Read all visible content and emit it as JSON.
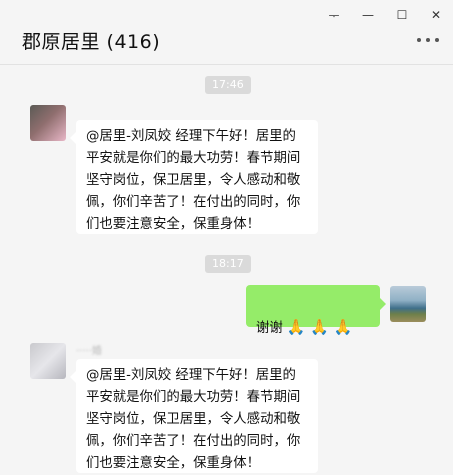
{
  "window": {
    "title": "郡原居里 (416)",
    "controls": {
      "pin_icon": "pin-icon",
      "minimize_icon": "minimize-icon",
      "maximize_icon": "maximize-icon",
      "close_icon": "close-icon",
      "pin_glyph": "ᅮ",
      "minimize_glyph": "—",
      "maximize_glyph": "☐",
      "close_glyph": "✕"
    },
    "more_icon": "more-icon"
  },
  "messages": [
    {
      "type": "timestamp",
      "text": "17:46"
    },
    {
      "type": "message",
      "side": "left",
      "text": "@居里-刘凤姣 经理下午好！居里的\n平安就是你们的最大功劳！春节期间\n坚守岗位，保卫居里，令人感动和敬\n佩，你们辛苦了！在付出的同时，你\n们也要注意安全，保重身体！"
    },
    {
      "type": "timestamp",
      "text": "18:17"
    },
    {
      "type": "message",
      "side": "right",
      "text": "谢谢",
      "emoji": "🙏 🙏 🙏"
    },
    {
      "type": "message",
      "side": "left",
      "sender": "·····婚",
      "text": "@居里-刘凤姣 经理下午好！居里的\n平安就是你们的最大功劳！春节期间\n坚守岗位，保卫居里，令人感动和敬\n佩，你们辛苦了！在付出的同时，你\n们也要注意安全，保重身体！"
    }
  ],
  "colors": {
    "background": "#f5f5f5",
    "bubble_self": "#95ec69",
    "bubble_other": "#ffffff",
    "timestamp_bg": "#dadada"
  }
}
